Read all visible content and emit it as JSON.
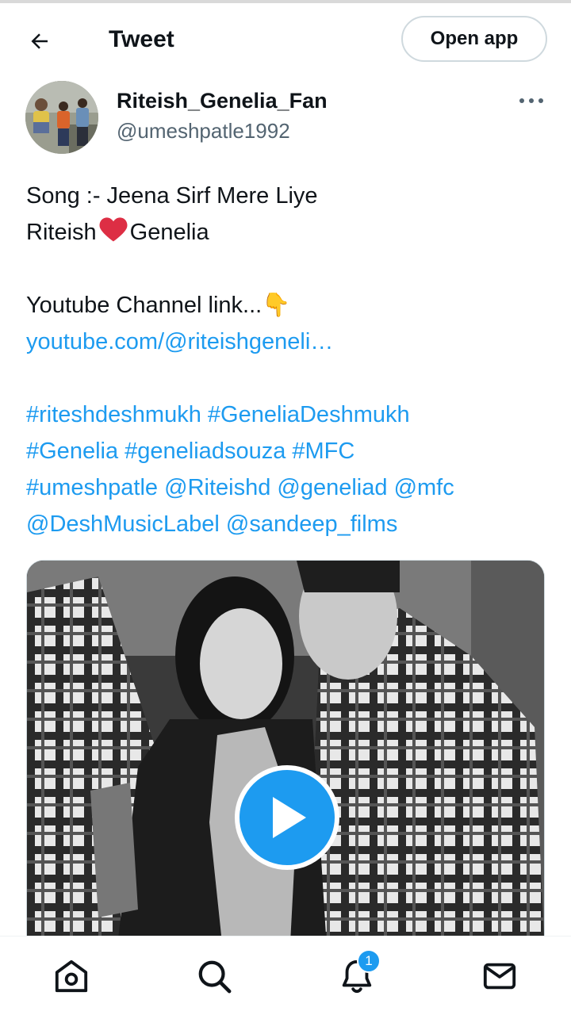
{
  "header": {
    "title": "Tweet",
    "open_app_label": "Open app",
    "back_icon": "arrow-left-icon"
  },
  "author": {
    "display_name": "Riteish_Genelia_Fan",
    "handle": "@umeshpatle1992",
    "more_icon": "more-horizontal-icon"
  },
  "tweet": {
    "song_line": "Song :- Jeena Sirf Mere Liye",
    "name_left": "Riteish",
    "name_right": "Genelia",
    "channel_line": "Youtube Channel link...",
    "channel_emoji": "👇",
    "youtube_link": "youtube.com/@riteishgeneli…",
    "hashtags_row1": [
      "#riteshdeshmukh",
      "#GeneliaDeshmukh"
    ],
    "hashtags_row2": [
      "#Genelia",
      "#geneliadsouza",
      "#MFC"
    ],
    "row3": [
      "#umeshpatle",
      "@Riteishd",
      "@geneliad",
      "@mfc"
    ],
    "row4": [
      "@DeshMusicLabel",
      "@sandeep_films"
    ]
  },
  "media": {
    "type": "video",
    "play_icon": "play-icon"
  },
  "bottom_nav": {
    "items": [
      "home-icon",
      "search-icon",
      "notifications-icon",
      "messages-icon"
    ],
    "notification_count": "1"
  },
  "colors": {
    "link": "#1d9bf0",
    "text": "#0f1419",
    "secondary": "#536471"
  }
}
